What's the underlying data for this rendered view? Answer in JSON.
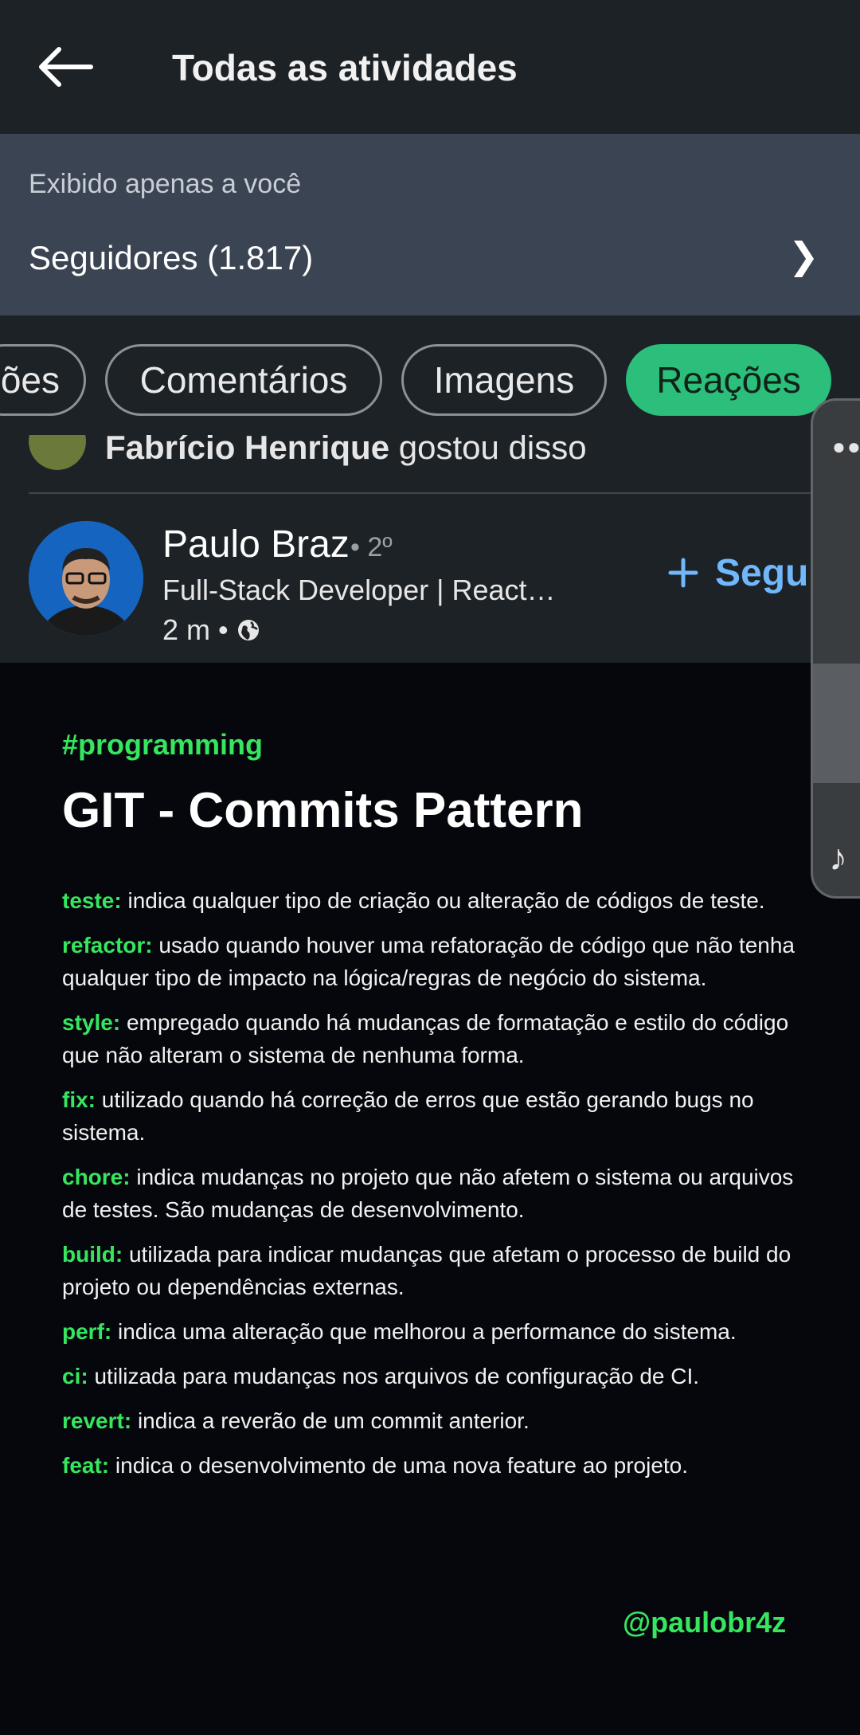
{
  "header": {
    "title": "Todas as atividades"
  },
  "followers_panel": {
    "visibility_note": "Exibido apenas a você",
    "followers_label": "Seguidores (1.817)"
  },
  "filters": [
    {
      "label": "ões",
      "active": false
    },
    {
      "label": "Comentários",
      "active": false
    },
    {
      "label": "Imagens",
      "active": false
    },
    {
      "label": "Reações",
      "active": true
    }
  ],
  "previous_activity": {
    "actor": "Fabrício Henrique",
    "action": "gostou disso"
  },
  "post": {
    "author": "Paulo Braz",
    "degree": "• 2º",
    "headline": "Full-Stack Developer | React…",
    "time": "2 m •",
    "follow_label": "Segu",
    "image": {
      "hashtag": "#programming",
      "title": "GIT - Commits Pattern",
      "commits": [
        {
          "type": "teste:",
          "desc": " indica qualquer tipo de criação ou alteração de códigos de teste."
        },
        {
          "type": "refactor:",
          "desc": "usado quando houver uma refatoração de código que não tenha qualquer tipo de impacto na lógica/regras de negócio do sistema."
        },
        {
          "type": "style:",
          "desc": "empregado quando há mudanças de formatação e estilo do código que não alteram o sistema de nenhuma forma."
        },
        {
          "type": "fix:",
          "desc": "utilizado quando há correção de erros que estão gerando bugs no sistema."
        },
        {
          "type": "chore:",
          "desc": "indica mudanças no projeto que não afetem o sistema ou arquivos de testes. São mudanças de desenvolvimento."
        },
        {
          "type": "build:",
          "desc": "utilizada para indicar mudanças que afetam o processo de build do projeto ou dependências externas."
        },
        {
          "type": "perf:",
          "desc": "indica uma alteração que melhorou a performance do sistema."
        },
        {
          "type": "ci:",
          "desc": "utilizada para mudanças nos arquivos de configuração de CI."
        },
        {
          "type": "revert:",
          "desc": "indica a reverão de um commit anterior."
        },
        {
          "type": "feat:",
          "desc": "indica o desenvolvimento de uma nova feature ao projeto."
        }
      ],
      "handle": "@paulobr4z"
    }
  },
  "colors": {
    "accent_green": "#35e65e",
    "chip_active": "#2bbf7b",
    "link_blue": "#71b7fb"
  },
  "icons": {
    "back": "arrow-left-icon",
    "chevron": "chevron-right-icon",
    "globe": "globe-icon",
    "plus": "plus-icon",
    "music": "music-note-icon"
  }
}
